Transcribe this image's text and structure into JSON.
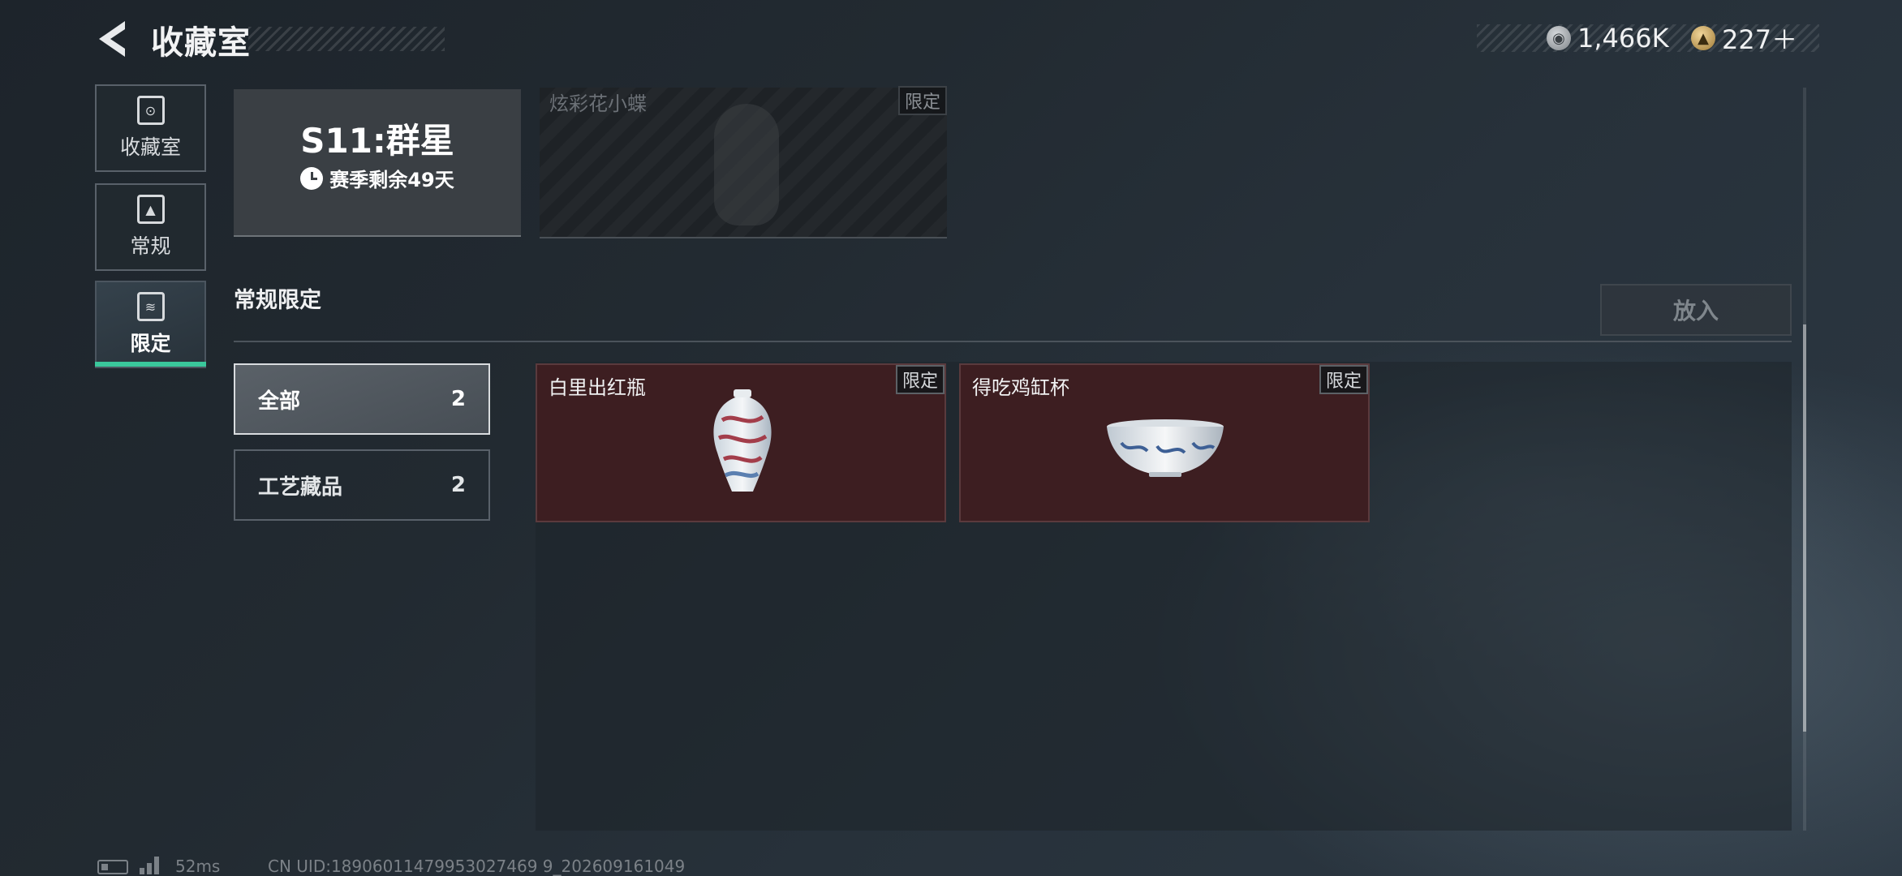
{
  "header": {
    "title": "收藏室",
    "currencies": [
      {
        "icon": "silver-coin-icon",
        "value": "1,466K"
      },
      {
        "icon": "gold-coin-icon",
        "value": "227＋"
      }
    ]
  },
  "sidebar": {
    "items": [
      {
        "label": "收藏室",
        "icon": "collection-icon",
        "active": false
      },
      {
        "label": "常规",
        "icon": "document-icon",
        "active": false
      },
      {
        "label": "限定",
        "icon": "image-icon",
        "active": true
      }
    ]
  },
  "season": {
    "title": "S11:群星",
    "remaining": "赛季剩余49天"
  },
  "locked_item": {
    "name": "炫彩花小蝶",
    "tag": "限定"
  },
  "section": {
    "title": "常规限定",
    "put_button": "放入"
  },
  "filters": [
    {
      "label": "全部",
      "count": "2",
      "active": true
    },
    {
      "label": "工艺藏品",
      "count": "2",
      "active": false
    }
  ],
  "items": [
    {
      "name": "白里出红瓶",
      "tag": "限定",
      "icon": "vase-icon"
    },
    {
      "name": "得吃鸡缸杯",
      "tag": "限定",
      "icon": "bowl-icon"
    }
  ],
  "footer": {
    "ping": "52ms",
    "uid": "CN UID:18906011479953027469 9_202609161049"
  },
  "colors": {
    "accent": "#3ac79b",
    "item_bg": "#3d1e21"
  }
}
